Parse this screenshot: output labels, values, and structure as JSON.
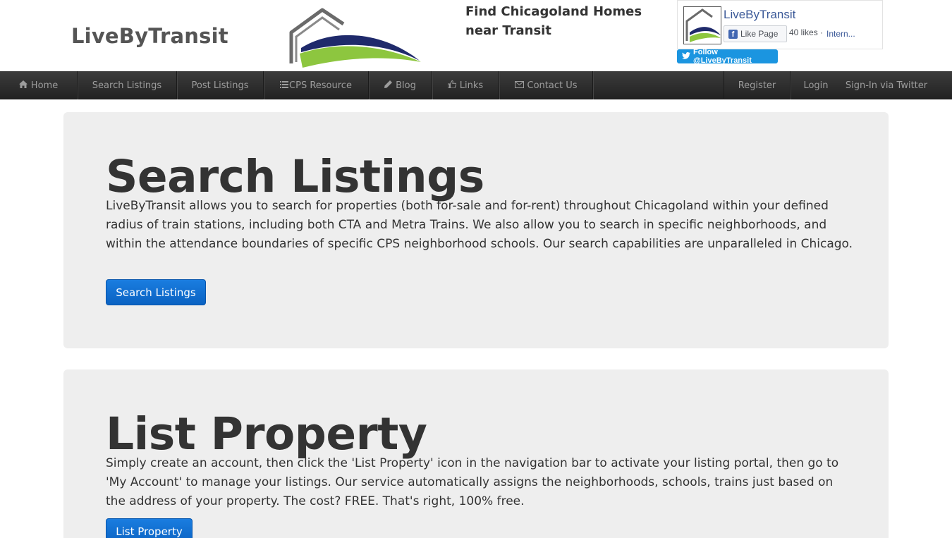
{
  "header": {
    "brand": "LiveByTransit",
    "tagline": "Find Chicagoland Homes near Transit",
    "colors": {
      "logo_gray": "#6a6a6a",
      "logo_navy": "#1f2a6b",
      "logo_green": "#8dc63f"
    }
  },
  "facebook": {
    "page_name": "LiveByTransit",
    "like_label": "Like Page",
    "likes_text": "40 likes ·",
    "category_text": "Intern..."
  },
  "twitter": {
    "follow_label": "Follow @LiveByTransit"
  },
  "nav": {
    "home": "Home",
    "search": "Search Listings",
    "post": "Post Listings",
    "cps": "CPS Resource",
    "blog": "Blog",
    "links": "Links",
    "contact": "Contact Us",
    "register": "Register",
    "login": "Login",
    "twitter_signin": "Sign-In via Twitter"
  },
  "sections": {
    "search": {
      "heading": "Search Listings",
      "body": "LiveByTransit allows you to search for properties (both for-sale and for-rent) throughout Chicagoland within your defined radius of train stations, including both CTA and Metra Trains. We also allow you to search in specific neighborhoods, and within the attendance boundaries of specific CPS neighborhood schools. Our search capabilities are unparalleled in Chicago.",
      "button": "Search Listings"
    },
    "list": {
      "heading": "List Property",
      "body": "Simply create an account, then click the 'List Property' icon in the navigation bar to activate your listing portal, then go to 'My Account' to manage your listings. Our service automatically assigns the neighborhoods, schools, trains just based on the address of your property. The cost? FREE. That's right, 100% free.",
      "button": "List Property"
    }
  }
}
